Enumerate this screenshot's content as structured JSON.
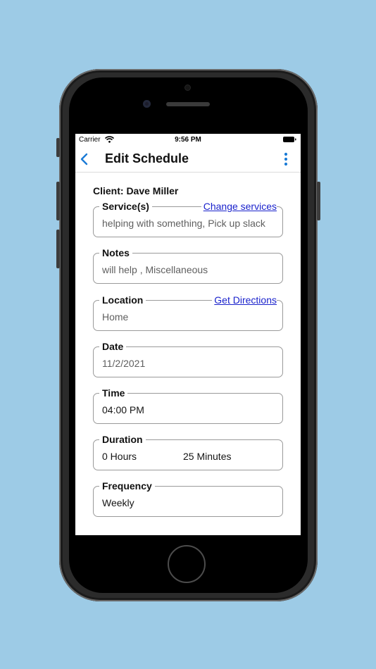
{
  "status_bar": {
    "carrier": "Carrier",
    "time": "9:56 PM"
  },
  "nav": {
    "title": "Edit Schedule",
    "back_icon": "chevron-left-icon",
    "more_icon": "vertical-ellipsis-icon"
  },
  "client": {
    "label": "Client: Dave Miller"
  },
  "fields": {
    "services": {
      "label": "Service(s)",
      "link": "Change services",
      "value": "helping with something, Pick up slack"
    },
    "notes": {
      "label": "Notes",
      "value": "will help , Miscellaneous"
    },
    "location": {
      "label": "Location",
      "link": "Get Directions",
      "value": "Home"
    },
    "date": {
      "label": "Date",
      "value": "11/2/2021"
    },
    "time": {
      "label": "Time",
      "value": "04:00 PM"
    },
    "duration": {
      "label": "Duration",
      "hours": "0 Hours",
      "minutes": "25 Minutes"
    },
    "frequency": {
      "label": "Frequency",
      "value": "Weekly"
    }
  },
  "colors": {
    "background": "#9dcbe6",
    "accent": "#1a7bd6",
    "link": "#1a22cc"
  }
}
